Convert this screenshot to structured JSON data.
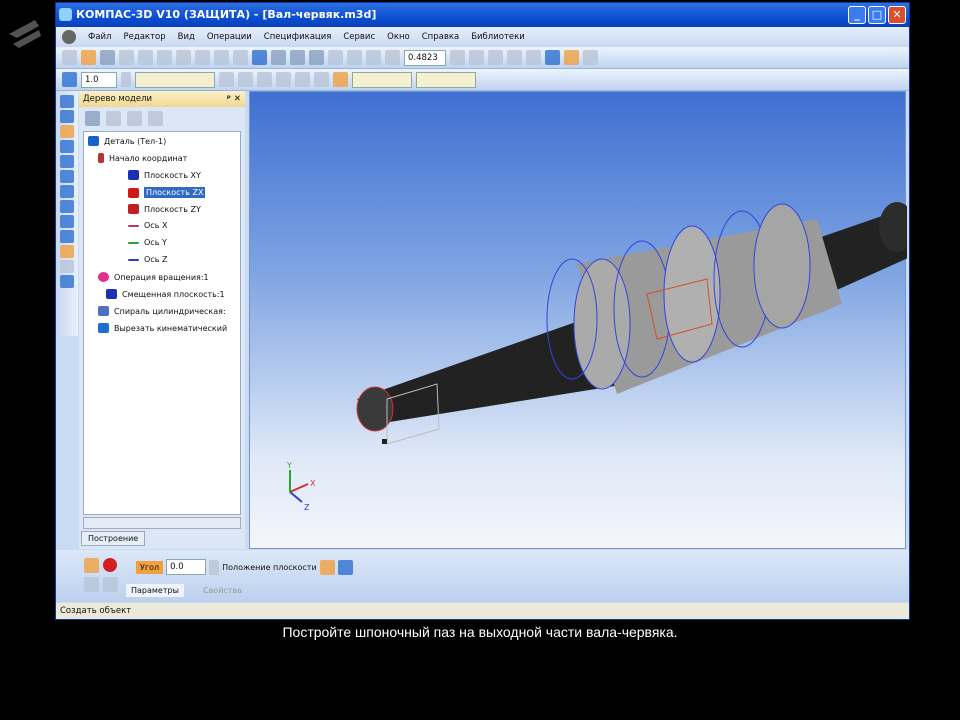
{
  "window": {
    "title": "КОМПАС-3D V10 (ЗАЩИТА) - [Вал-червяк.m3d]"
  },
  "menu": [
    "Файл",
    "Редактор",
    "Вид",
    "Операции",
    "Спецификация",
    "Сервис",
    "Окно",
    "Справка",
    "Библиотеки"
  ],
  "toolbar": {
    "zoom_value": "0.4823",
    "step_value": "1.0"
  },
  "tree": {
    "title": "Дерево модели",
    "tab": "Построение",
    "nodes": [
      {
        "label": "Деталь (Тел-1)",
        "color": "#1a5fd0"
      },
      {
        "label": "Начало координат",
        "color": "#c03030"
      },
      {
        "label": "Плоскость XY",
        "color": "#1c2fb0"
      },
      {
        "label": "Плоскость ZX",
        "color": "#d01818"
      },
      {
        "label": "Плоскость ZY",
        "color": "#c02020"
      },
      {
        "label": "Ось X",
        "color": "#c03060"
      },
      {
        "label": "Ось Y",
        "color": "#30a030"
      },
      {
        "label": "Ось Z",
        "color": "#3040c0"
      },
      {
        "label": "Операция вращения:1",
        "color": "#e0308a"
      },
      {
        "label": "Смещенная плоскость:1",
        "color": "#1c2fb0"
      },
      {
        "label": "Спираль цилиндрическая:",
        "color": "#5070c0"
      },
      {
        "label": "Вырезать кинематический",
        "color": "#1a70d0"
      }
    ]
  },
  "props": {
    "angle_label": "Угол",
    "angle_value": "0.0",
    "position_label": "Положение плоскости",
    "tab_params": "Параметры",
    "tab_props": "Свойства"
  },
  "status": "Создать объект",
  "subtitle": "Постройте шпоночный паз на выходной части вала-червяка.",
  "axes": {
    "x": "X",
    "y": "Y",
    "z": "Z"
  }
}
